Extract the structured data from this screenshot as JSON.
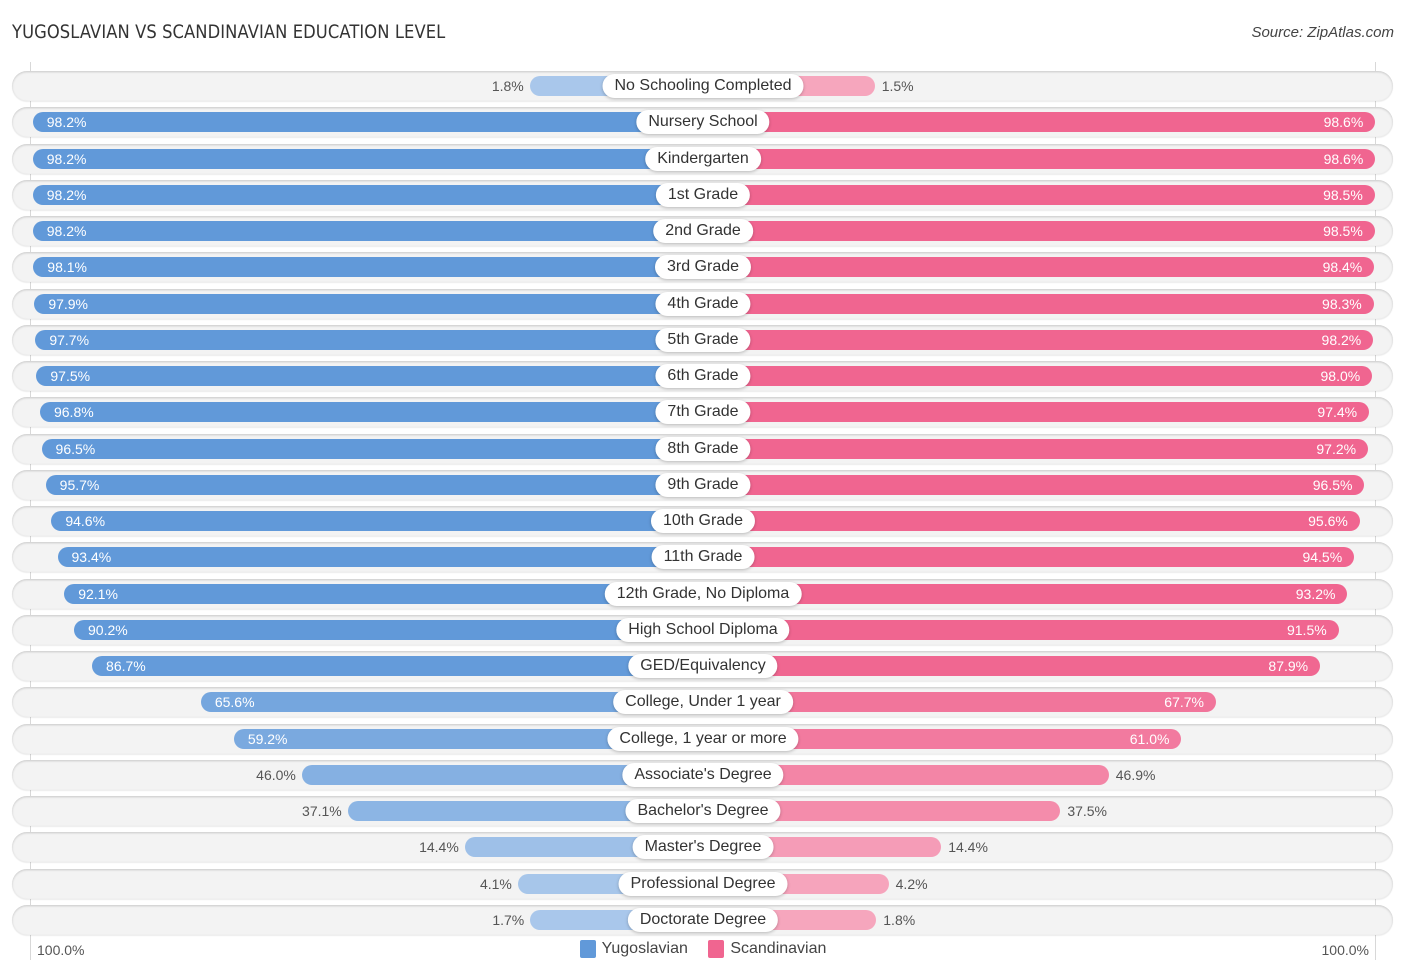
{
  "header": {
    "title": "YUGOSLAVIAN VS SCANDINAVIAN EDUCATION LEVEL",
    "source": "Source: ZipAtlas.com"
  },
  "colors": {
    "yugoslavian_strong": "#6199d9",
    "yugoslavian_light": "#aac8eb",
    "scandinavian_strong": "#f06590",
    "scandinavian_light": "#f6a7be"
  },
  "axis": {
    "left_label": "100.0%",
    "right_label": "100.0%"
  },
  "legend": {
    "items": [
      {
        "label": "Yugoslavian"
      },
      {
        "label": "Scandinavian"
      }
    ]
  },
  "chart_data": {
    "type": "bar",
    "orientation": "horizontal-diverging",
    "title": "YUGOSLAVIAN VS SCANDINAVIAN EDUCATION LEVEL",
    "xlim": [
      0,
      100
    ],
    "unit": "%",
    "legend_position": "bottom-center",
    "categories": [
      "No Schooling Completed",
      "Nursery School",
      "Kindergarten",
      "1st Grade",
      "2nd Grade",
      "3rd Grade",
      "4th Grade",
      "5th Grade",
      "6th Grade",
      "7th Grade",
      "8th Grade",
      "9th Grade",
      "10th Grade",
      "11th Grade",
      "12th Grade, No Diploma",
      "High School Diploma",
      "GED/Equivalency",
      "College, Under 1 year",
      "College, 1 year or more",
      "Associate's Degree",
      "Bachelor's Degree",
      "Master's Degree",
      "Professional Degree",
      "Doctorate Degree"
    ],
    "series": [
      {
        "name": "Yugoslavian",
        "side": "left",
        "values": [
          1.8,
          98.2,
          98.2,
          98.2,
          98.2,
          98.1,
          97.9,
          97.7,
          97.5,
          96.8,
          96.5,
          95.7,
          94.6,
          93.4,
          92.1,
          90.2,
          86.7,
          65.6,
          59.2,
          46.0,
          37.1,
          14.4,
          4.1,
          1.7
        ]
      },
      {
        "name": "Scandinavian",
        "side": "right",
        "values": [
          1.5,
          98.6,
          98.6,
          98.5,
          98.5,
          98.4,
          98.3,
          98.2,
          98.0,
          97.4,
          97.2,
          96.5,
          95.6,
          94.5,
          93.2,
          91.5,
          87.9,
          67.7,
          61.0,
          46.9,
          37.5,
          14.4,
          4.2,
          1.8
        ]
      }
    ]
  }
}
